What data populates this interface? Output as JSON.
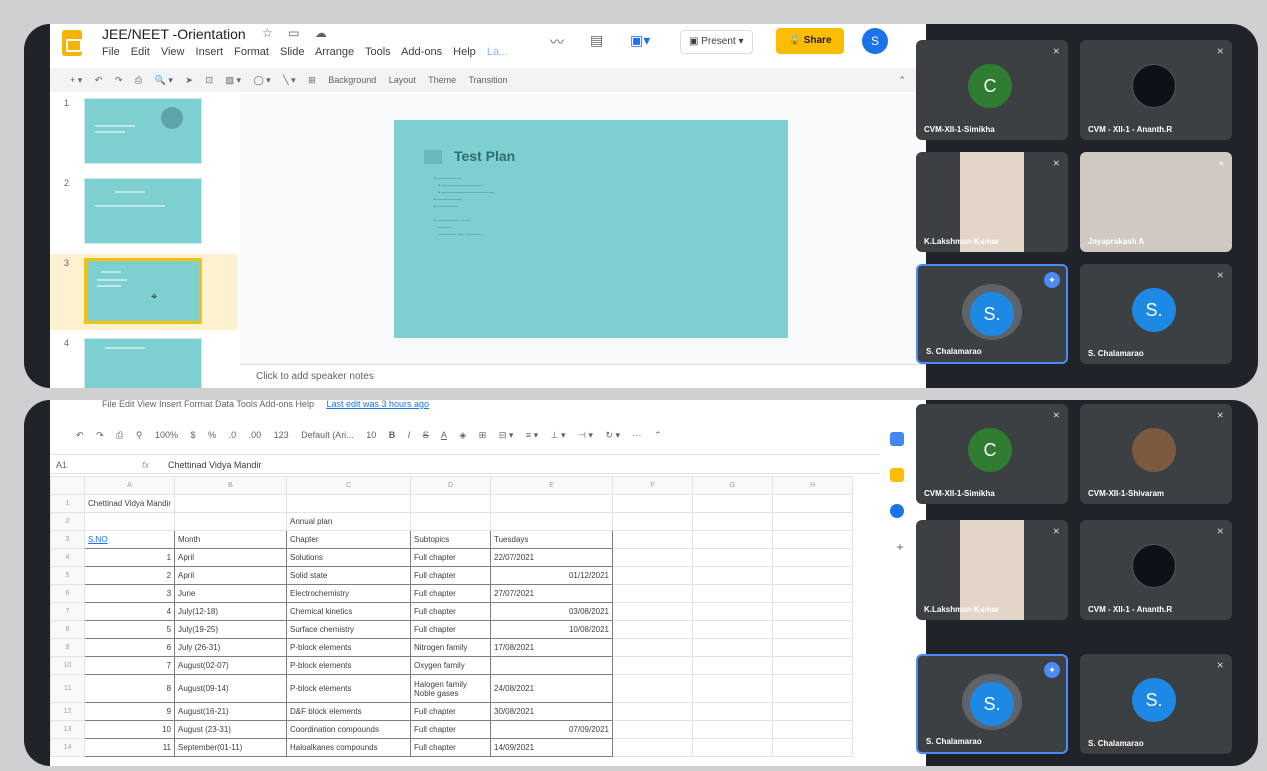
{
  "slides": {
    "title": "JEE/NEET -Orientation",
    "menu": [
      "File",
      "Edit",
      "View",
      "Insert",
      "Format",
      "Slide",
      "Arrange",
      "Tools",
      "Add-ons",
      "Help",
      "La..."
    ],
    "present_label": "Present",
    "share_label": "Share",
    "avatar_letter": "S",
    "toolbar": [
      "Background",
      "Layout",
      "Theme",
      "Transition"
    ],
    "thumbnails": [
      "1",
      "2",
      "3",
      "4"
    ],
    "selected_thumb": 3,
    "slide_title": "Test Plan",
    "speaker_notes": "Click to add speaker notes"
  },
  "meet_top": {
    "tiles": [
      {
        "name": "CVM-XII-1-Simikha",
        "avatar": "C",
        "color": "#2e7d32",
        "type": "avatar"
      },
      {
        "name": "CVM - XII-1 - Ananth.R",
        "type": "dark"
      },
      {
        "name": "K.Lakshman Kumar",
        "type": "photo"
      },
      {
        "name": "Jayaprakash A",
        "type": "photo2"
      },
      {
        "name": "S. Chalamarao",
        "avatar": "S.",
        "color": "#1e88e5",
        "type": "avatar",
        "active": true
      },
      {
        "name": "S. Chalamarao",
        "avatar": "S.",
        "color": "#1e88e5",
        "type": "avatar"
      }
    ]
  },
  "sheets": {
    "menu": [
      "File",
      "Edit",
      "View",
      "Insert",
      "Format",
      "Data",
      "Tools",
      "Add-ons",
      "Help"
    ],
    "last_edit": "Last edit was 3 hours ago",
    "toolbar": [
      "100%",
      "$",
      "%",
      ".0",
      ".00",
      "123",
      "Default (Ari...",
      "10",
      "B",
      "I",
      "S",
      "A"
    ],
    "cell_ref": "A1",
    "formula_value": "Chettinad Vidya Mandir",
    "col_headers": [
      "A",
      "B",
      "C",
      "D",
      "E",
      "F",
      "G",
      "H"
    ],
    "rows": [
      {
        "n": "1",
        "cells": [
          "Chettinad Vidya Mandir",
          "",
          "",
          "",
          "",
          "",
          "",
          ""
        ]
      },
      {
        "n": "2",
        "cells": [
          "",
          "",
          "Annual plan",
          "",
          "",
          "",
          "",
          ""
        ]
      },
      {
        "n": "3",
        "cells": [
          "S.NO",
          "Month",
          "Chapter",
          "Subtopics",
          "Tuesdays",
          "",
          "",
          ""
        ]
      },
      {
        "n": "4",
        "cells": [
          "1",
          "April",
          "Solutions",
          "Full chapter",
          "22/07/2021",
          "",
          "",
          ""
        ]
      },
      {
        "n": "5",
        "cells": [
          "2",
          "April",
          "Solid state",
          "Full chapter",
          "01/12/2021",
          "",
          "",
          ""
        ]
      },
      {
        "n": "6",
        "cells": [
          "3",
          "June",
          "Electrochemistry",
          "Full chapter",
          "27/07/2021",
          "",
          "",
          ""
        ]
      },
      {
        "n": "7",
        "cells": [
          "4",
          "July(12-18)",
          "Chemical kinetics",
          "Full chapter",
          "03/08/2021",
          "",
          "",
          ""
        ]
      },
      {
        "n": "8",
        "cells": [
          "5",
          "July(19-25)",
          "Surface chemistry",
          "Full chapter",
          "10/08/2021",
          "",
          "",
          ""
        ]
      },
      {
        "n": "9",
        "cells": [
          "6",
          "July (26-31)",
          "P-block elements",
          "Nitrogen family",
          "17/08/2021",
          "",
          "",
          ""
        ]
      },
      {
        "n": "10",
        "cells": [
          "7",
          "August(02-07)",
          "P-block elements",
          "Oxygen family",
          "",
          "",
          "",
          ""
        ]
      },
      {
        "n": "11",
        "cells": [
          "8",
          "August(09-14)",
          "P-block elements",
          "Halogen family Noble gases",
          "24/08/2021",
          "",
          "",
          ""
        ]
      },
      {
        "n": "12",
        "cells": [
          "9",
          "August(16-21)",
          "D&F block elements",
          "Full chapter",
          "30/08/2021",
          "",
          "",
          ""
        ]
      },
      {
        "n": "13",
        "cells": [
          "10",
          "August (23-31)",
          "Coordination compounds",
          "Full chapter",
          "07/09/2021",
          "",
          "",
          ""
        ]
      },
      {
        "n": "14",
        "cells": [
          "11",
          "September(01-11)",
          "Haloalkanes compounds",
          "Full chapter",
          "14/09/2021",
          "",
          "",
          ""
        ]
      }
    ]
  },
  "meet_bottom": {
    "tiles": [
      {
        "name": "CVM-XII-1-Simikha",
        "avatar": "C",
        "color": "#2e7d32",
        "type": "avatar"
      },
      {
        "name": "CVM-XII-1-Shivaram",
        "type": "photo3"
      },
      {
        "name": "K.Lakshman Kumar",
        "type": "photo"
      },
      {
        "name": "CVM - XII-1 - Ananth.R",
        "type": "dark"
      },
      {
        "name": "S. Chalamarao",
        "avatar": "S.",
        "color": "#1e88e5",
        "type": "avatar",
        "active": true
      },
      {
        "name": "S. Chalamarao",
        "avatar": "S.",
        "color": "#1e88e5",
        "type": "avatar"
      }
    ]
  }
}
